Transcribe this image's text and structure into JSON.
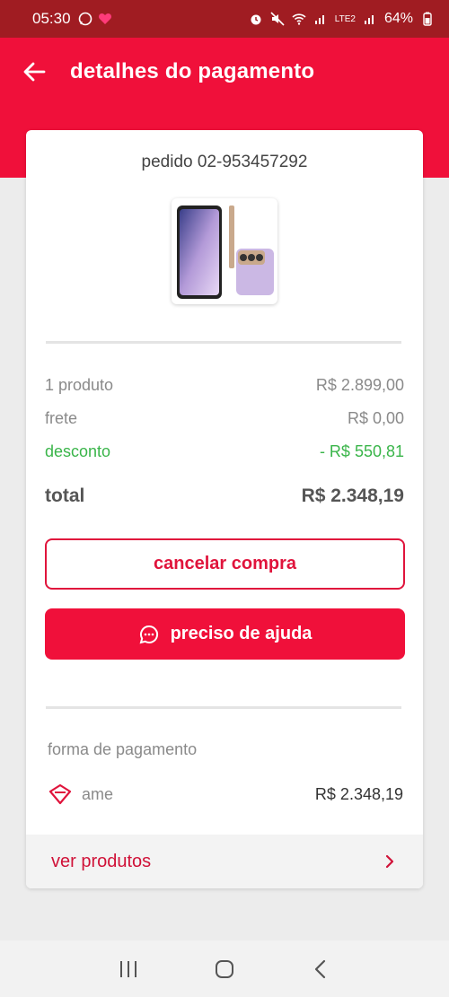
{
  "status": {
    "time": "05:30",
    "battery": "64%",
    "network": "LTE2"
  },
  "header": {
    "title": "detalhes do pagamento"
  },
  "order": {
    "number": "pedido 02-953457292",
    "product_image": "phone-product-image"
  },
  "summary": {
    "products_label": "1 produto",
    "products_value": "R$ 2.899,00",
    "shipping_label": "frete",
    "shipping_value": "R$ 0,00",
    "discount_label": "desconto",
    "discount_value": "- R$ 550,81",
    "total_label": "total",
    "total_value": "R$ 2.348,19"
  },
  "actions": {
    "cancel_label": "cancelar compra",
    "help_label": "preciso de ajuda"
  },
  "payment": {
    "section_label": "forma de pagamento",
    "method_label": "ame",
    "method_amount": "R$ 2.348,19"
  },
  "footer_link": {
    "label": "ver produtos"
  },
  "colors": {
    "brand_red": "#f0103a",
    "discount_green": "#3ab54a"
  }
}
